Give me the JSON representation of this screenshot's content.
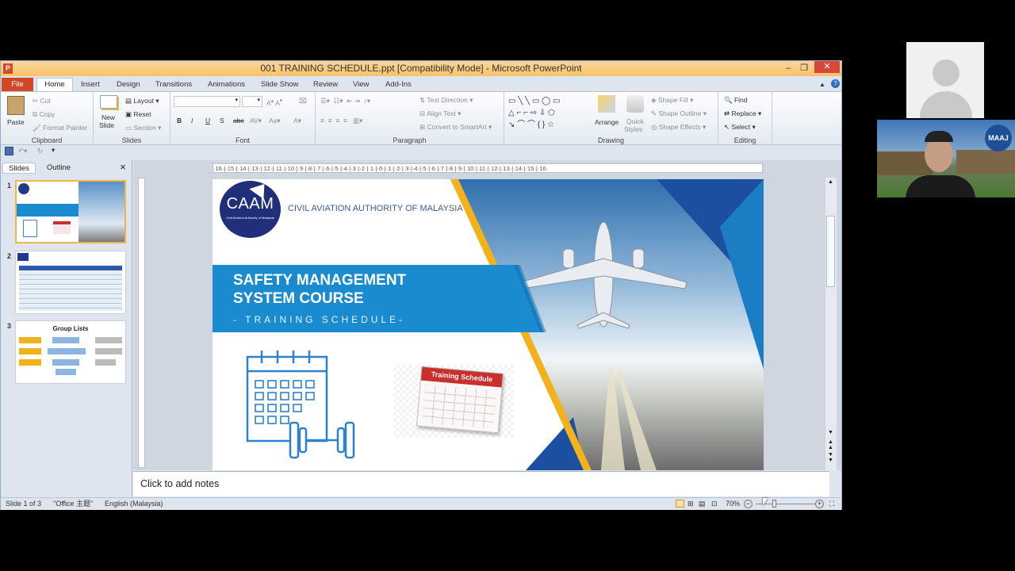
{
  "window": {
    "title": "001 TRAINING SCHEDULE.ppt [Compatibility Mode]  -  Microsoft PowerPoint",
    "app_letter": "P"
  },
  "tabs": [
    "File",
    "Home",
    "Insert",
    "Design",
    "Transitions",
    "Animations",
    "Slide Show",
    "Review",
    "View",
    "Add-Ins"
  ],
  "ribbon": {
    "clipboard": {
      "paste": "Paste",
      "cut": "Cut",
      "copy": "Copy",
      "format_painter": "Format Painter",
      "label": "Clipboard"
    },
    "slides": {
      "new_slide_1": "New",
      "new_slide_2": "Slide",
      "layout": "Layout",
      "reset": "Reset",
      "section": "Section",
      "label": "Slides"
    },
    "font": {
      "label": "Font"
    },
    "paragraph": {
      "text_direction": "Text Direction",
      "align_text": "Align Text",
      "convert_smartart": "Convert to SmartArt",
      "label": "Paragraph"
    },
    "drawing": {
      "arrange": "Arrange",
      "quick_styles_1": "Quick",
      "quick_styles_2": "Styles",
      "shape_fill": "Shape Fill",
      "shape_outline": "Shape Outline",
      "shape_effects": "Shape Effects",
      "label": "Drawing"
    },
    "editing": {
      "find": "Find",
      "replace": "Replace",
      "select": "Select",
      "label": "Editing"
    }
  },
  "panel": {
    "tab_slides": "Slides",
    "tab_outline": "Outline",
    "thumbs": [
      {
        "num": "1"
      },
      {
        "num": "2"
      },
      {
        "num": "3",
        "title": "Group Lists"
      }
    ]
  },
  "ruler": {
    "h": "·16·|·15·|·14·|·13·|·12·|·11·|·10·|·9·|·8·|·7·|·6·|·5·|·4·|·3·|·2·|·1·|·0·|·1·|·2·|·3·|·4·|·5·|·6·|·7·|·8·|·9·|·10·|·11·|·12·|·13·|·14·|·15·|·16·"
  },
  "slide": {
    "logo_text": "CAAM",
    "logo_sub": "Civil Aviation Authority of Malaysia",
    "org_name": "CIVIL AVIATION AUTHORITY OF MALAYSIA",
    "title_line1": "SAFETY MANAGEMENT",
    "title_line2": "SYSTEM COURSE",
    "subtitle": "-  TRAINING SCHEDULE-",
    "calendar_label": "Training Schedule"
  },
  "notes": {
    "placeholder": "Click to add notes"
  },
  "status": {
    "slide_count": "Slide 1 of 3",
    "theme": "\"Office 主题\"",
    "language": "English (Malaysia)",
    "zoom": "70%"
  },
  "video": {
    "badge": "MAAJ"
  },
  "colors": {
    "accent_blue": "#1b8bd0",
    "navy": "#1d3b8a",
    "file_tab": "#d24726",
    "gold": "#f2b21b"
  }
}
